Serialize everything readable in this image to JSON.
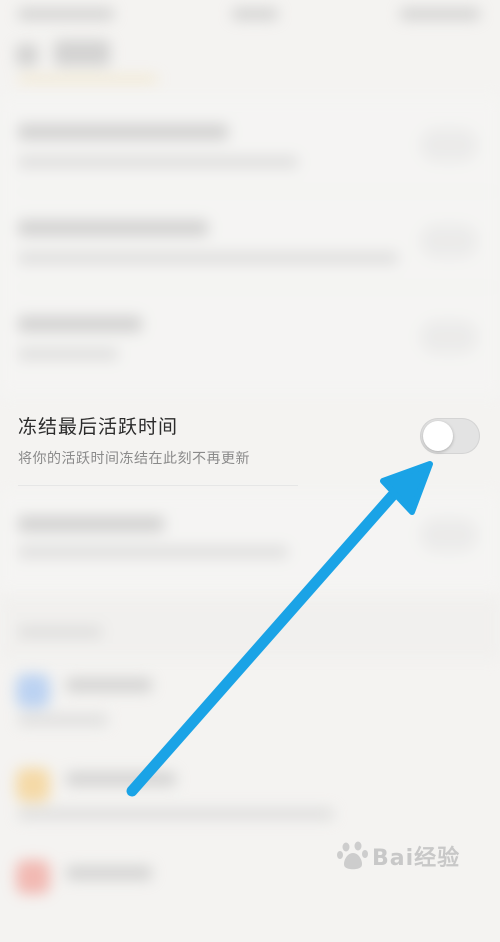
{
  "settings_item": {
    "title": "冻结最后活跃时间",
    "subtitle": "将你的活跃时间冻结在此刻不再更新",
    "toggle_state": "off"
  },
  "watermark": {
    "text": "Bai经验"
  },
  "colors": {
    "arrow": "#1aa3e6",
    "toggle_track_off": "#e3e3e3",
    "title_text": "#2b2b2b",
    "subtitle_text": "#8a8a8a"
  },
  "icons": [
    "back-arrow-icon",
    "pointer-arrow-icon",
    "baidu-paw-icon"
  ]
}
